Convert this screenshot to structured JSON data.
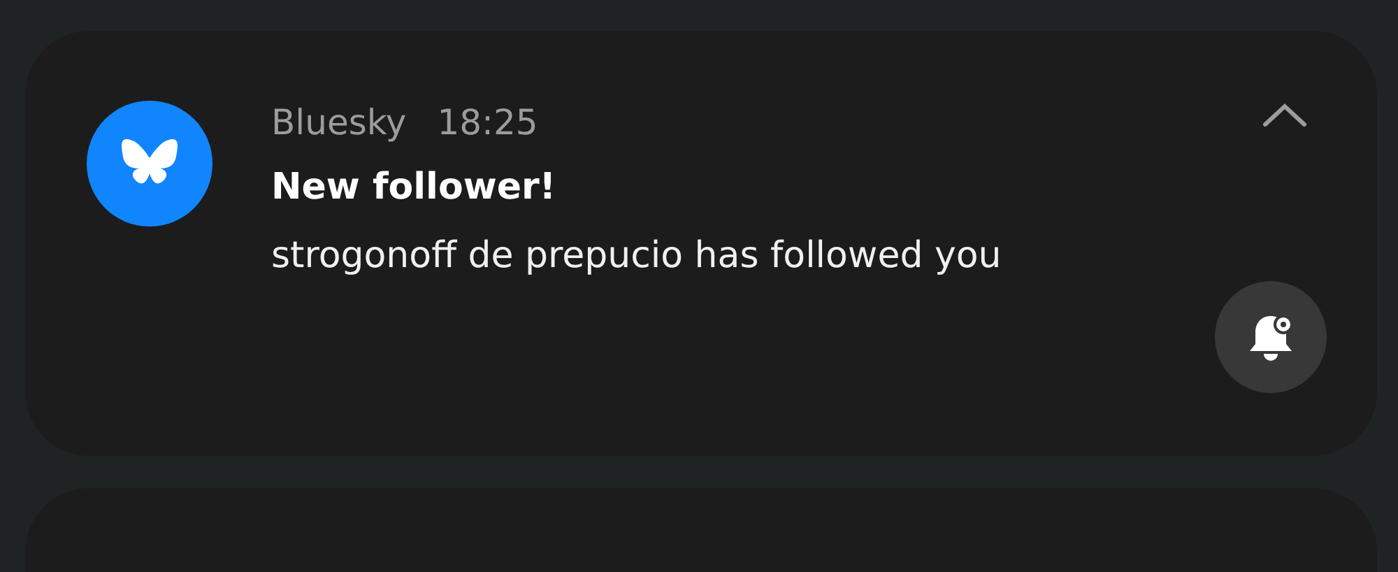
{
  "notification": {
    "app": "Bluesky",
    "time": "18:25",
    "title": "New follower!",
    "body": "strogonoff de prepucio has followed you",
    "expanded": true
  }
}
